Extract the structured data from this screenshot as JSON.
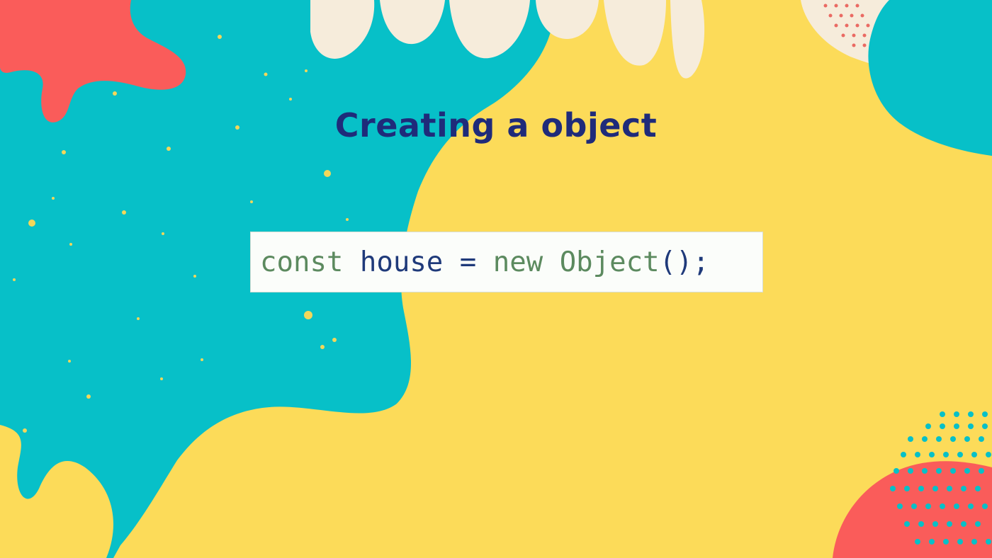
{
  "slide": {
    "title": "Creating a object"
  },
  "code": {
    "tokens": [
      {
        "text": "const",
        "role": "keyword"
      },
      {
        "text": " ",
        "role": "plain"
      },
      {
        "text": "house",
        "role": "identifier"
      },
      {
        "text": " = ",
        "role": "plain"
      },
      {
        "text": "new",
        "role": "keyword"
      },
      {
        "text": " ",
        "role": "plain"
      },
      {
        "text": "Object",
        "role": "class"
      },
      {
        "text": "();",
        "role": "identifier"
      }
    ]
  },
  "colors": {
    "background_yellow": "#fcdb59",
    "teal": "#07c0c8",
    "coral": "#fa5c5a",
    "cream": "#f6ecdb",
    "title_navy": "#1f2b7a",
    "code_keyword": "#5c8a5f",
    "code_identifier": "#1f3a7a",
    "code_background": "#fbfdfa"
  }
}
